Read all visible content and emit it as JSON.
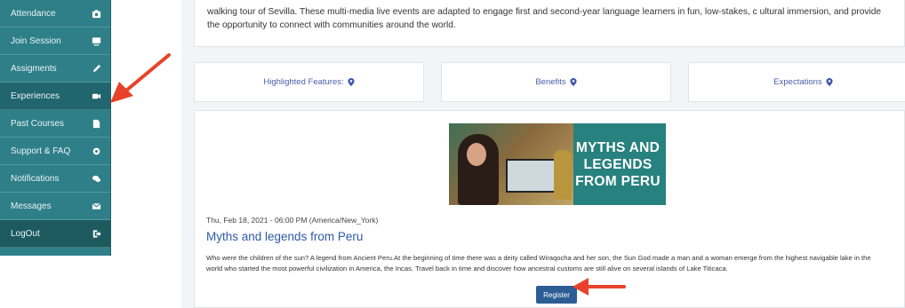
{
  "sidebar": {
    "items": [
      {
        "label": "Attendance",
        "icon": "camera-icon"
      },
      {
        "label": "Join Session",
        "icon": "monitor-icon"
      },
      {
        "label": "Assigments",
        "icon": "pencil-icon"
      },
      {
        "label": "Experiences",
        "icon": "video-icon"
      },
      {
        "label": "Past Courses",
        "icon": "file-icon"
      },
      {
        "label": "Support & FAQ",
        "icon": "gear-icon"
      },
      {
        "label": "Notifications",
        "icon": "chat-icon"
      },
      {
        "label": "Messages",
        "icon": "envelope-icon"
      },
      {
        "label": "LogOut",
        "icon": "logout-icon"
      }
    ]
  },
  "intro": {
    "text": "walking tour of Sevilla. These multi-media live events are adapted to engage first and second-year language learners in fun, low-stakes, c ultural immersion, and provide the opportunity to connect with communities around the world."
  },
  "tabs": [
    {
      "label": "Highlighted Features:"
    },
    {
      "label": "Benefits"
    },
    {
      "label": "Expectations"
    }
  ],
  "event": {
    "banner_text": "MYTHS AND LEGENDS FROM PERU",
    "date": "Thu, Feb 18, 2021 - 06:00 PM (America/New_York)",
    "title": "Myths and legends from Peru",
    "description_line1": "Who were the children of the sun? A legend from Ancient Peru.At the beginning of time there was a deity called Wiraqocha and her son, the Sun God made a man and a woman emerge from the highest navigable lake in the",
    "description_line2": "world who started the most powerful civilization in America, the Incas. Travel back in time and discover how ancestral customs are still alive on several islands of Lake Titicaca.",
    "register_label": "Register"
  },
  "colors": {
    "sidebar_bg": "#2f7f88",
    "accent_blue": "#2e5aa8",
    "button_bg": "#2c5d95",
    "arrow_red": "#e8432a"
  }
}
